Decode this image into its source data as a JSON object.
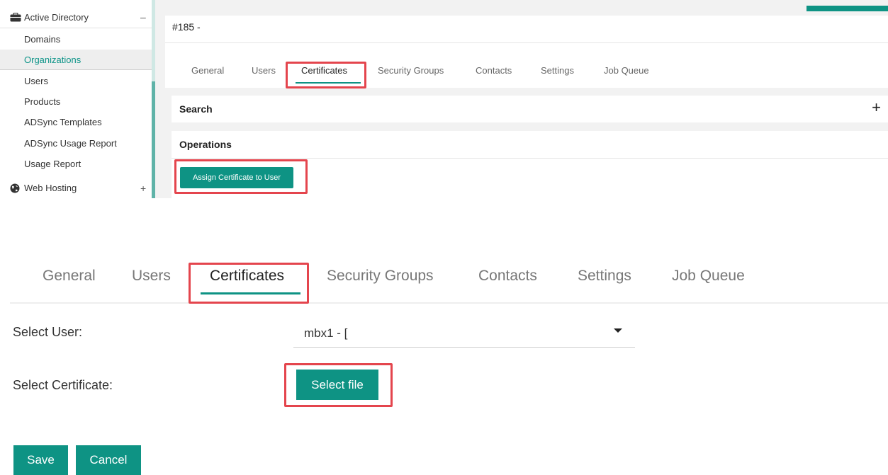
{
  "sidebar": {
    "section_active_directory": {
      "label": "Active Directory",
      "toggle": "–",
      "icon": "briefcase-icon"
    },
    "items": [
      {
        "label": "Domains"
      },
      {
        "label": "Organizations",
        "active": true
      },
      {
        "label": "Users"
      },
      {
        "label": "Products"
      },
      {
        "label": "ADSync Templates"
      },
      {
        "label": "ADSync Usage Report"
      },
      {
        "label": "Usage Report"
      }
    ],
    "section_web_hosting": {
      "label": "Web Hosting",
      "toggle": "+",
      "icon": "globe-icon"
    }
  },
  "top_panel": {
    "title": "#185 -",
    "tabs": [
      {
        "label": "General"
      },
      {
        "label": "Users"
      },
      {
        "label": "Certificates",
        "active": true
      },
      {
        "label": "Security Groups"
      },
      {
        "label": "Contacts"
      },
      {
        "label": "Settings"
      },
      {
        "label": "Job Queue"
      }
    ],
    "search_label": "Search",
    "search_toggle": "+",
    "operations_label": "Operations",
    "assign_button": "Assign Certificate to User"
  },
  "bottom_panel": {
    "tabs": [
      {
        "label": "General"
      },
      {
        "label": "Users"
      },
      {
        "label": "Certificates",
        "active": true
      },
      {
        "label": "Security Groups"
      },
      {
        "label": "Contacts"
      },
      {
        "label": "Settings"
      },
      {
        "label": "Job Queue"
      }
    ],
    "select_user_label": "Select User:",
    "select_user_value": "mbx1 - [",
    "select_certificate_label": "Select Certificate:",
    "select_file_button": "Select file",
    "save_button": "Save",
    "cancel_button": "Cancel"
  },
  "colors": {
    "accent": "#0e9384",
    "highlight": "#e4454d",
    "active_link": "#0d9488"
  }
}
